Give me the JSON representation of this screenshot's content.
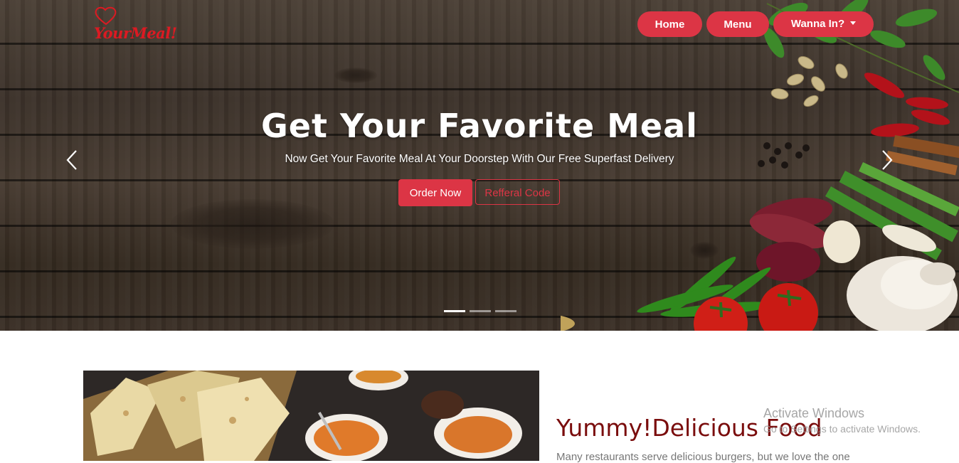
{
  "brand": {
    "logo_text": "YourMeal!"
  },
  "nav": {
    "home": "Home",
    "menu": "Menu",
    "dropdown": "Wanna In?"
  },
  "hero": {
    "title": "Get Your Favorite Meal",
    "subtitle": "Now Get Your Favorite Meal At Your Doorstep With Our Free Superfast Delivery",
    "order_button": "Order Now",
    "referral_button": "Refferal Code",
    "slide_count": 3,
    "active_slide": 1
  },
  "section": {
    "title": "Yummy!Delicious Food",
    "text": "Many restaurants serve delicious burgers, but we love the one"
  },
  "watermark": {
    "line1": "Activate Windows",
    "line2": "Go to Settings to activate Windows."
  },
  "colors": {
    "accent": "#dc3545",
    "logo": "#dc1a22",
    "section_title": "#7a0d0d"
  }
}
